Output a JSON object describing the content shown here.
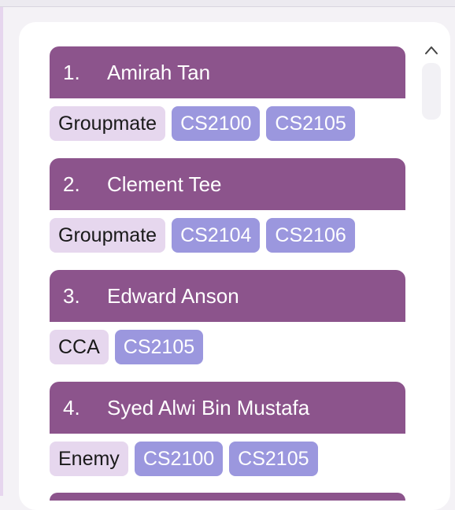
{
  "contacts": [
    {
      "index": "1.",
      "name": "Amirah Tan",
      "type_tag": "Groupmate",
      "modules": [
        "CS2100",
        "CS2105"
      ]
    },
    {
      "index": "2.",
      "name": "Clement Tee",
      "type_tag": "Groupmate",
      "modules": [
        "CS2104",
        "CS2106"
      ]
    },
    {
      "index": "3.",
      "name": "Edward Anson",
      "type_tag": "CCA",
      "modules": [
        "CS2105"
      ]
    },
    {
      "index": "4.",
      "name": "Syed Alwi Bin Mustafa",
      "type_tag": "Enemy",
      "modules": [
        "CS2100",
        "CS2105"
      ]
    }
  ],
  "scrollbar": {
    "up_icon": "chevron-up-icon"
  },
  "colors": {
    "header": "#8c548c",
    "type_tag": "#e6d7ee",
    "module_tag": "#9b97de"
  }
}
